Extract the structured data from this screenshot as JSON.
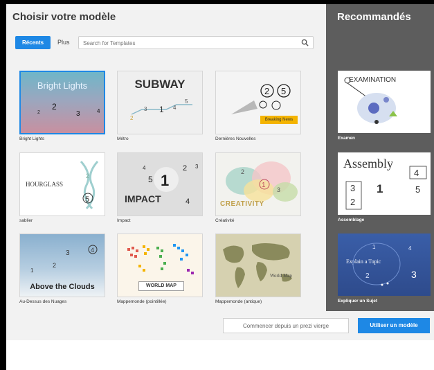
{
  "dialog": {
    "title": "Choisir votre modèle",
    "tabs": {
      "recent": "Récents",
      "more": "Plus"
    },
    "search": {
      "placeholder": "Search for Templates"
    }
  },
  "templates": [
    {
      "label": "Bright Lights",
      "thumb_text": "Bright Lights"
    },
    {
      "label": "Métro",
      "thumb_text": "SUBWAY"
    },
    {
      "label": "Dernières Nouvelles",
      "thumb_text": "Breaking News"
    },
    {
      "label": "sablier",
      "thumb_text": "HOURGLASS"
    },
    {
      "label": "Impact",
      "thumb_text": "IMPACT"
    },
    {
      "label": "Créativité",
      "thumb_text": "CREATIVITY"
    },
    {
      "label": "Au-Dessus des Nuages",
      "thumb_text": "Above the Clouds"
    },
    {
      "label": "Mappemonde (pointillée)",
      "thumb_text": "WORLD MAP"
    },
    {
      "label": "Mappemonde (antique)",
      "thumb_text": "World Map"
    }
  ],
  "recommended": {
    "title": "Recommandés",
    "items": [
      {
        "label": "Examen",
        "thumb_text": "EXAMINATION"
      },
      {
        "label": "Assemblage",
        "thumb_text": "Assembly"
      },
      {
        "label": "Expliquer un Sujet",
        "thumb_text": "Explain a Topic"
      }
    ]
  },
  "footer": {
    "blank_label": "Commencer depuis un prezi vierge",
    "use_label": "Utiliser un modèle"
  },
  "colors": {
    "accent": "#1e88e5",
    "sidebar": "#5d5d5d"
  }
}
